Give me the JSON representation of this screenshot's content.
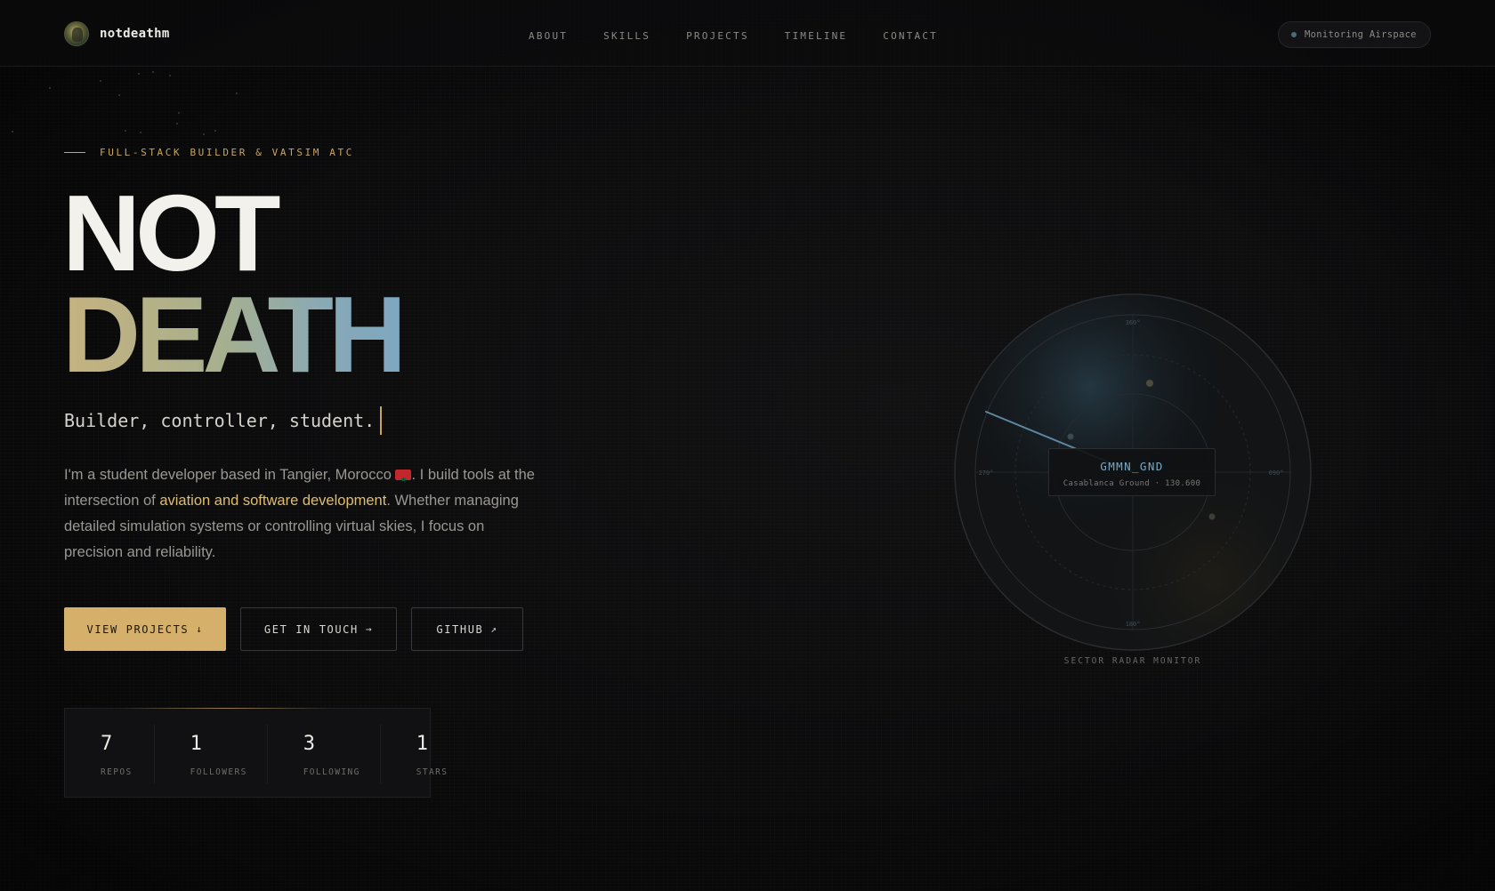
{
  "header": {
    "brand_name": "notdeathm",
    "nav": [
      "ABOUT",
      "SKILLS",
      "PROJECTS",
      "TIMELINE",
      "CONTACT"
    ],
    "status": "Monitoring Airspace"
  },
  "hero": {
    "eyebrow": "FULL-STACK BUILDER & VATSIM ATC",
    "title_line1": "NOT",
    "title_line2": "DEATH",
    "tagline": "Builder, controller, student.",
    "bio_part1": "I'm a student developer based in Tangier, Morocco ",
    "bio_part2": ". I build tools at the intersection of ",
    "bio_highlight": "aviation and software development",
    "bio_part3": ". Whether managing detailed simulation systems or controlling virtual skies, I focus on precision and reliability.",
    "buttons": {
      "view_projects": "VIEW PROJECTS",
      "view_projects_arrow": "↓",
      "get_in_touch": "GET IN TOUCH",
      "get_in_touch_arrow": "→",
      "github": "GITHUB",
      "github_arrow": "↗"
    }
  },
  "stats": [
    {
      "value": "7",
      "label": "REPOS"
    },
    {
      "value": "1",
      "label": "FOLLOWERS"
    },
    {
      "value": "3",
      "label": "FOLLOWING"
    },
    {
      "value": "1",
      "label": "STARS"
    }
  ],
  "radar": {
    "compass": {
      "n": "360°",
      "e": "090°",
      "s": "180°",
      "w": "270°"
    },
    "card_code": "GMMN_GND",
    "card_sub": "Casablanca Ground · 130.600",
    "label": "SECTOR RADAR MONITOR"
  },
  "colors": {
    "accent_gold": "#d4b06a",
    "accent_blue": "#7ea7c0",
    "background": "#0b0b0c"
  }
}
